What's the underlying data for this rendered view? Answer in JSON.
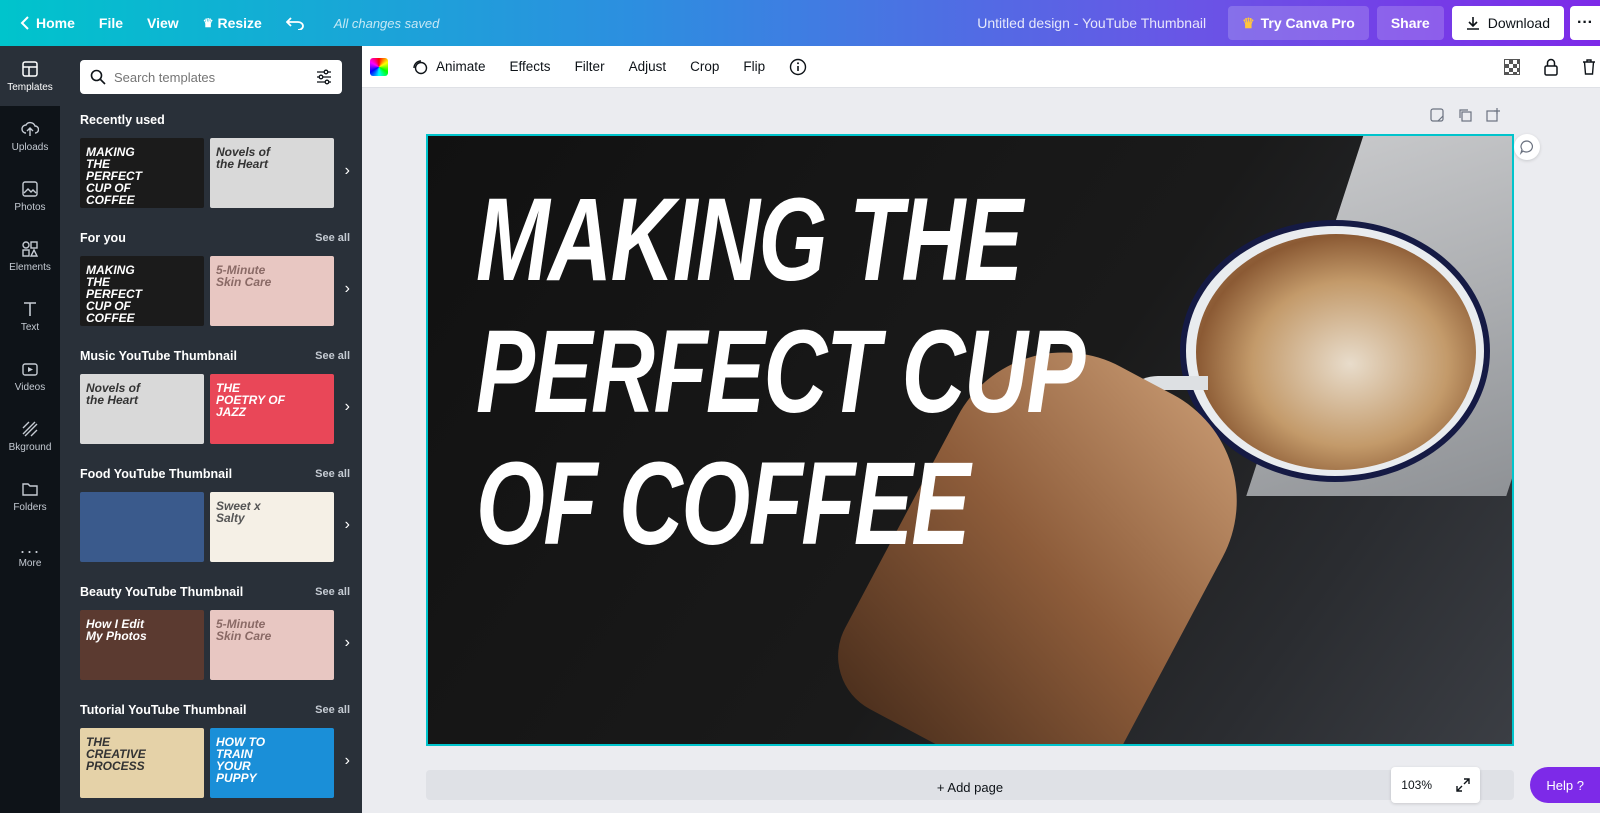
{
  "topbar": {
    "home": "Home",
    "file": "File",
    "view": "View",
    "resize": "Resize",
    "saved_status": "All changes saved",
    "design_title": "Untitled design - YouTube Thumbnail",
    "try_pro": "Try Canva Pro",
    "share": "Share",
    "download": "Download"
  },
  "nav": [
    {
      "label": "Templates",
      "icon": "templates-icon"
    },
    {
      "label": "Uploads",
      "icon": "upload-icon"
    },
    {
      "label": "Photos",
      "icon": "photo-icon"
    },
    {
      "label": "Elements",
      "icon": "elements-icon"
    },
    {
      "label": "Text",
      "icon": "text-icon"
    },
    {
      "label": "Videos",
      "icon": "video-icon"
    },
    {
      "label": "Bkground",
      "icon": "background-icon"
    },
    {
      "label": "Folders",
      "icon": "folder-icon"
    },
    {
      "label": "More",
      "icon": "more-icon"
    }
  ],
  "search": {
    "placeholder": "Search templates"
  },
  "sections": [
    {
      "title": "Recently used",
      "see_all": "",
      "thumbs": [
        {
          "text": "MAKING THE PERFECT CUP OF COFFEE",
          "bg": "#1b1b1b",
          "fg": "#ffffff"
        },
        {
          "text": "Novels of the Heart",
          "bg": "#d9d9d9",
          "fg": "#333333"
        }
      ]
    },
    {
      "title": "For you",
      "see_all": "See all",
      "thumbs": [
        {
          "text": "MAKING THE PERFECT CUP OF COFFEE",
          "bg": "#1b1b1b",
          "fg": "#ffffff"
        },
        {
          "text": "5-Minute Skin Care",
          "bg": "#e8c7c2",
          "fg": "#8a6a66"
        }
      ]
    },
    {
      "title": "Music YouTube Thumbnail",
      "see_all": "See all",
      "thumbs": [
        {
          "text": "Novels of the Heart",
          "bg": "#d9d9d9",
          "fg": "#333333"
        },
        {
          "text": "THE POETRY OF JAZZ",
          "bg": "#e94758",
          "fg": "#ffffff"
        }
      ]
    },
    {
      "title": "Food YouTube Thumbnail",
      "see_all": "See all",
      "thumbs": [
        {
          "text": "",
          "bg": "#3a5a8c",
          "fg": "#ffffff"
        },
        {
          "text": "Sweet x Salty",
          "bg": "#f5f0e6",
          "fg": "#555555"
        }
      ]
    },
    {
      "title": "Beauty YouTube Thumbnail",
      "see_all": "See all",
      "thumbs": [
        {
          "text": "How I Edit My Photos",
          "bg": "#5b3a30",
          "fg": "#ffffff"
        },
        {
          "text": "5-Minute Skin Care",
          "bg": "#e8c7c2",
          "fg": "#8a6a66"
        }
      ]
    },
    {
      "title": "Tutorial YouTube Thumbnail",
      "see_all": "See all",
      "thumbs": [
        {
          "text": "THE CREATIVE PROCESS",
          "bg": "#e5d2a8",
          "fg": "#333333"
        },
        {
          "text": "HOW TO TRAIN YOUR PUPPY",
          "bg": "#1a8fd8",
          "fg": "#ffffff"
        }
      ]
    }
  ],
  "toolbar": {
    "animate": "Animate",
    "effects": "Effects",
    "filter": "Filter",
    "adjust": "Adjust",
    "crop": "Crop",
    "flip": "Flip"
  },
  "design": {
    "line1": "MAKING THE",
    "line2": "PERFECT CUP",
    "line3": "OF COFFEE"
  },
  "add_page": "+ Add page",
  "zoom": "103%",
  "help": "Help ?",
  "colors": {
    "accent": "#00c4cc",
    "brand_purple": "#7d2ae8"
  }
}
